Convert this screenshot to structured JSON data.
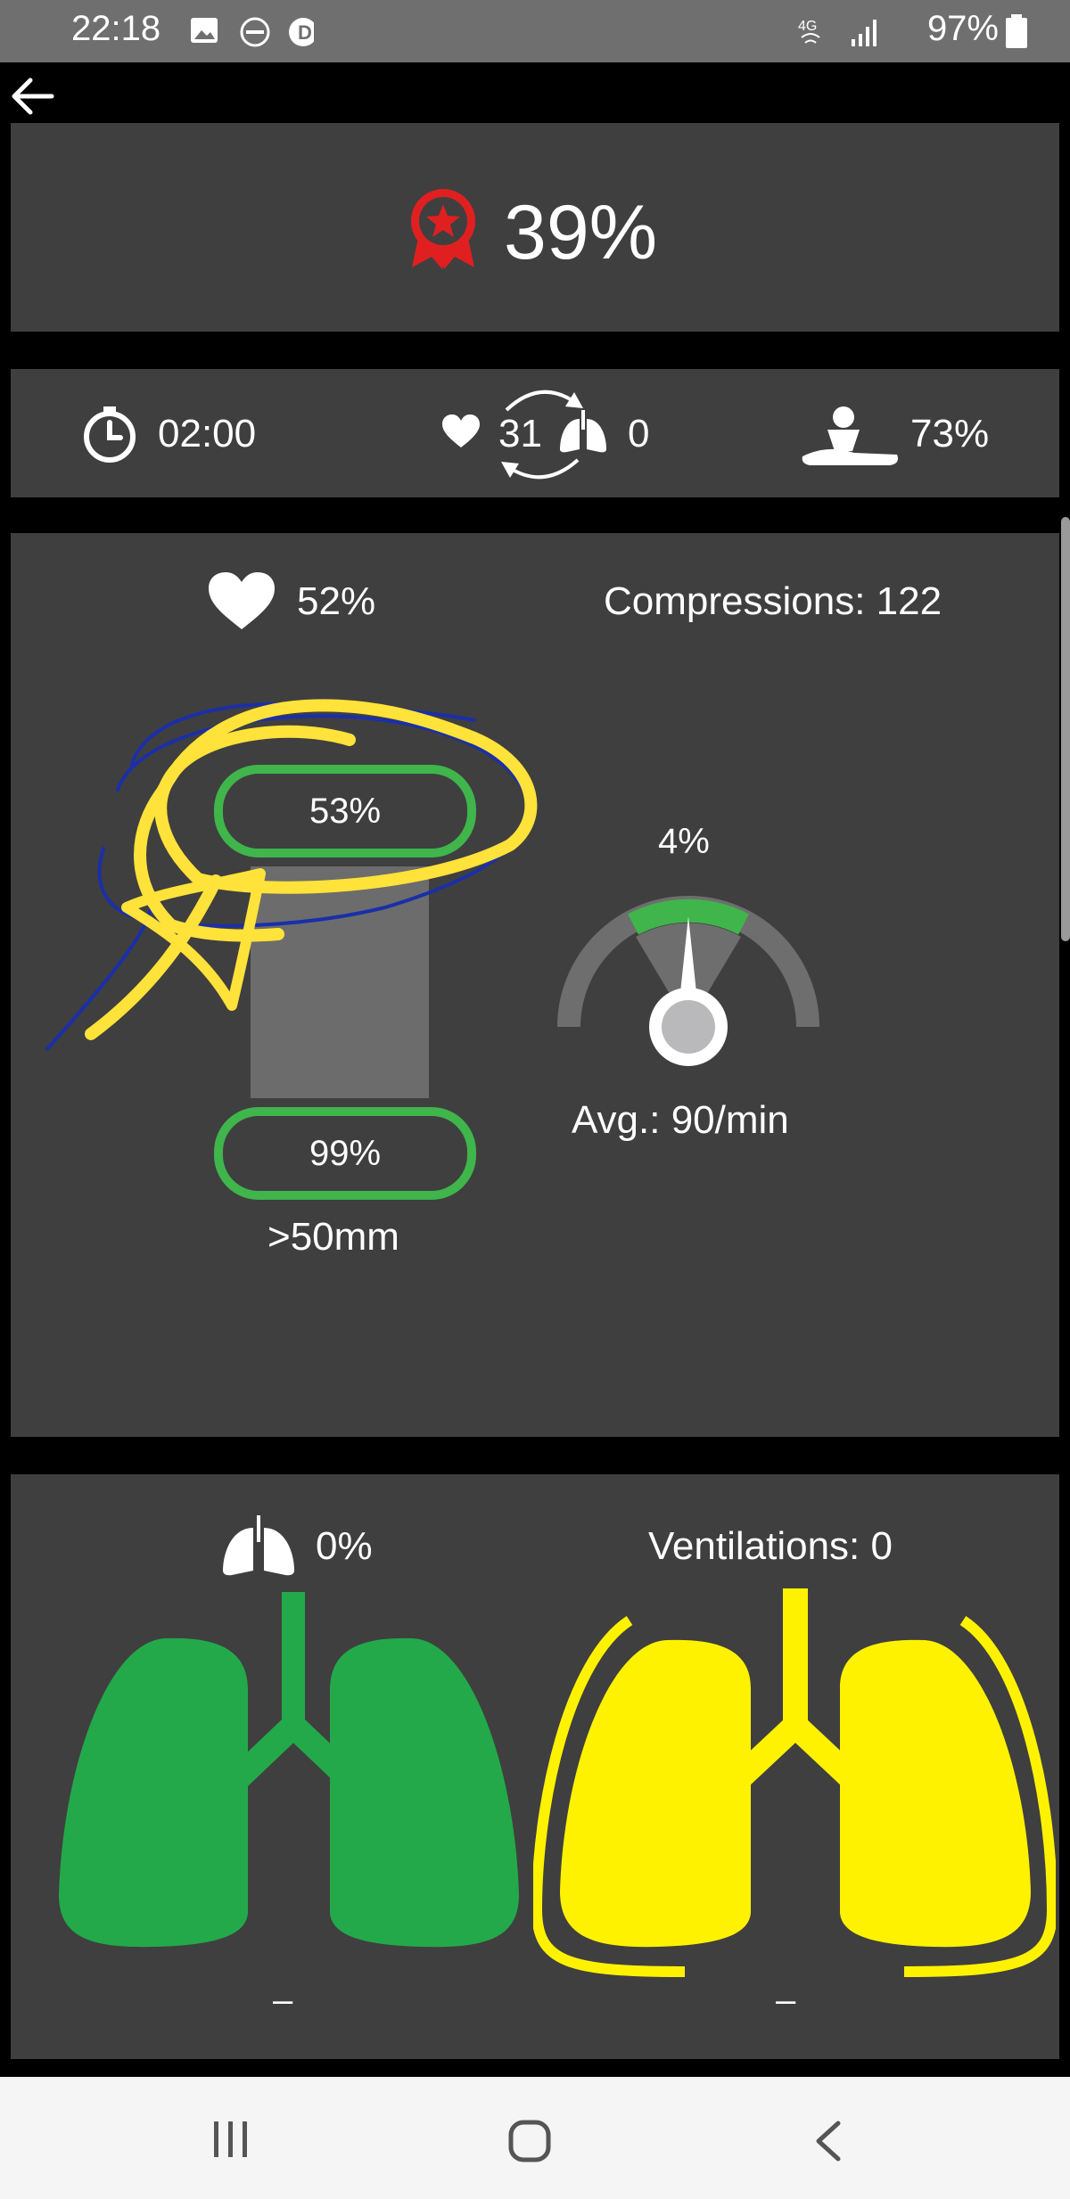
{
  "status_bar": {
    "time": "22:18",
    "battery": "97%",
    "icons": [
      "image-icon",
      "dnd-icon",
      "d-app-icon",
      "4g-icon",
      "signal-icon",
      "battery-icon"
    ]
  },
  "header": {
    "back_icon": "arrow-left-icon"
  },
  "score": {
    "icon": "award-ribbon-icon",
    "value": "39%"
  },
  "summary": {
    "timer": "02:00",
    "compressions_ratio": "31",
    "ventilations_ratio": "0",
    "cpr_percent": "73%"
  },
  "compressions": {
    "heart_percent": "52%",
    "label": "Compressions: 122",
    "recoil_percent": "53%",
    "depth_percent": "99%",
    "depth_target": ">50mm",
    "rate_percent": "4%",
    "average_rate": "Avg.: 90/min"
  },
  "ventilations": {
    "lung_percent": "0%",
    "label": "Ventilations: 0",
    "left_value": "–",
    "right_value": "–"
  },
  "colors": {
    "accent_green": "#3fb54b",
    "lung_green": "#23a949",
    "lung_yellow": "#fff200",
    "award_red": "#e02020",
    "annotation_yellow": "#ffe23a",
    "annotation_blue": "#1a2fa8"
  },
  "navbar": {
    "icons": [
      "recent-apps-icon",
      "home-icon",
      "back-icon"
    ]
  }
}
